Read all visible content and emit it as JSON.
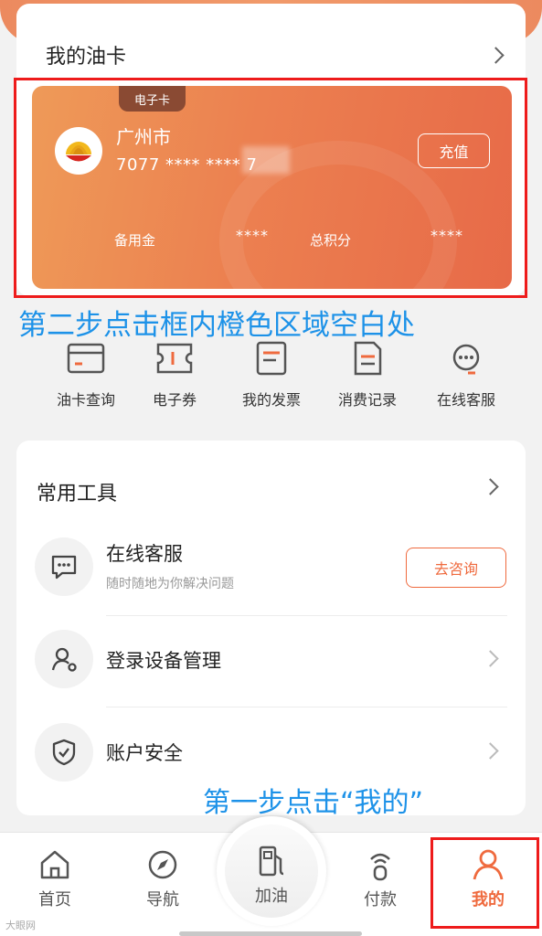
{
  "card_section": {
    "title": "我的油卡",
    "card": {
      "tag": "电子卡",
      "city": "广州市",
      "number": "7077 **** **** 7",
      "recharge_label": "充值",
      "reserve_label": "备用金",
      "reserve_value": "****",
      "points_label": "总积分",
      "points_value": "****"
    }
  },
  "annotations": {
    "step2": "第二步点击框内橙色区域空白处",
    "step1": "第一步点击“我的”"
  },
  "quick_actions": [
    {
      "label": "油卡查询",
      "icon": "card-query-icon"
    },
    {
      "label": "电子券",
      "icon": "coupon-icon"
    },
    {
      "label": "我的发票",
      "icon": "invoice-icon"
    },
    {
      "label": "消费记录",
      "icon": "record-icon"
    },
    {
      "label": "在线客服",
      "icon": "headset-icon"
    }
  ],
  "tools": {
    "title": "常用工具",
    "items": [
      {
        "title": "在线客服",
        "subtitle": "随时随地为你解决问题",
        "button": "去咨询",
        "icon": "chat-icon"
      },
      {
        "title": "登录设备管理",
        "icon": "device-user-icon"
      },
      {
        "title": "账户安全",
        "icon": "shield-icon"
      }
    ]
  },
  "tabbar": [
    {
      "label": "首页",
      "icon": "home-icon"
    },
    {
      "label": "导航",
      "icon": "compass-icon"
    },
    {
      "label": "加油",
      "icon": "fuel-pump-icon"
    },
    {
      "label": "付款",
      "icon": "pay-icon"
    },
    {
      "label": "我的",
      "icon": "person-icon",
      "active": true
    }
  ],
  "watermark": "大眼网",
  "colors": {
    "accent": "#ef6a3e",
    "card_gradient_start": "#ee9a58",
    "card_gradient_end": "#e76a48",
    "annotation_blue": "#1d92e8",
    "highlight_red": "#ee1b1b"
  }
}
